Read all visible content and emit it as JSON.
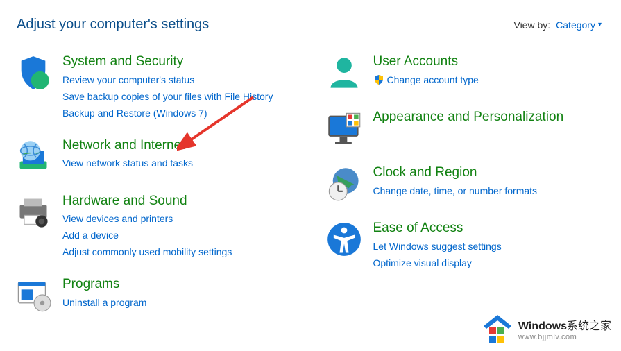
{
  "header": {
    "title": "Adjust your computer's settings",
    "viewby_label": "View by:",
    "viewby_value": "Category"
  },
  "categories": {
    "system_security": {
      "title": "System and Security",
      "links": [
        "Review your computer's status",
        "Save backup copies of your files with File History",
        "Backup and Restore (Windows 7)"
      ]
    },
    "network_internet": {
      "title": "Network and Internet",
      "links": [
        "View network status and tasks"
      ]
    },
    "hardware_sound": {
      "title": "Hardware and Sound",
      "links": [
        "View devices and printers",
        "Add a device",
        "Adjust commonly used mobility settings"
      ]
    },
    "programs": {
      "title": "Programs",
      "links": [
        "Uninstall a program"
      ]
    },
    "user_accounts": {
      "title": "User Accounts",
      "links": [
        "Change account type"
      ]
    },
    "appearance": {
      "title": "Appearance and Personalization"
    },
    "clock_region": {
      "title": "Clock and Region",
      "links": [
        "Change date, time, or number formats"
      ]
    },
    "ease_access": {
      "title": "Ease of Access",
      "links": [
        "Let Windows suggest settings",
        "Optimize visual display"
      ]
    }
  },
  "watermark": {
    "line1_bold": "Windows",
    "line1_rest": "系统之家",
    "line2": "www.bjjmlv.com"
  }
}
